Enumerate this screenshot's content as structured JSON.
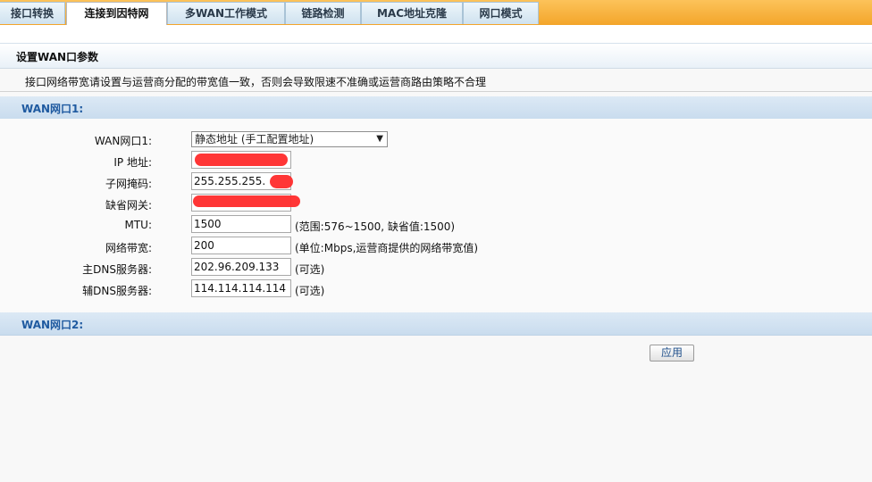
{
  "tabs": [
    {
      "label": "接口转换"
    },
    {
      "label": "连接到因特网"
    },
    {
      "label": "多WAN工作模式"
    },
    {
      "label": "链路检测"
    },
    {
      "label": "MAC地址克隆"
    },
    {
      "label": "网口模式"
    }
  ],
  "active_tab": "连接到因特网",
  "section": {
    "title": "设置WAN口参数",
    "notice": "接口网络带宽请设置与运营商分配的带宽值一致，否则会导致限速不准确或运营商路由策略不合理"
  },
  "wan1": {
    "header": "WAN网口1:",
    "mode_label": "WAN网口1:",
    "mode_value": "静态地址 (手工配置地址)",
    "ip_label": "IP 地址:",
    "ip_value": "",
    "mask_label": "子网掩码:",
    "mask_value": "255.255.255.",
    "gateway_label": "缺省网关:",
    "gateway_value": "",
    "mtu_label": "MTU:",
    "mtu_value": "1500",
    "mtu_hint": "(范围:576~1500, 缺省值:1500)",
    "bandwidth_label": "网络带宽:",
    "bandwidth_value": "200",
    "bandwidth_hint": "(单位:Mbps,运营商提供的网络带宽值)",
    "dns1_label": "主DNS服务器:",
    "dns1_value": "202.96.209.133",
    "dns1_hint": "(可选)",
    "dns2_label": "辅DNS服务器:",
    "dns2_value": "114.114.114.114",
    "dns2_hint": "(可选)"
  },
  "wan2": {
    "header": "WAN网口2:"
  },
  "apply_label": "应用",
  "colors": {
    "tabbar": "#f3a52a",
    "section_header": "#c9dcee",
    "header_text": "#1f5aa0",
    "redaction": "#ff2b2b"
  }
}
